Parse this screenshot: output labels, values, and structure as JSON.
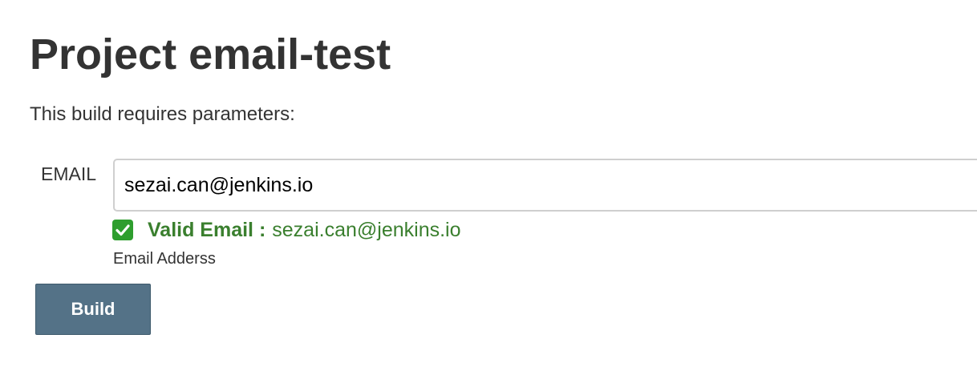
{
  "page": {
    "title": "Project email-test",
    "intro": "This build requires parameters:"
  },
  "parameter": {
    "name": "EMAIL",
    "value": "sezai.can@jenkins.io",
    "description": "Email Adderss",
    "validation": {
      "icon": "check-mark-icon",
      "label": "Valid Email :",
      "value": "sezai.can@jenkins.io",
      "color": "#3a7f2e"
    }
  },
  "actions": {
    "build_label": "Build",
    "button_color": "#547287"
  }
}
